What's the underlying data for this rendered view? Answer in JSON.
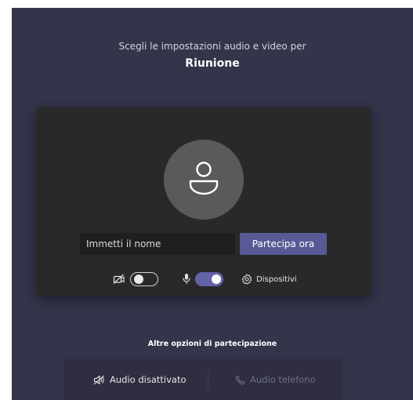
{
  "header": {
    "subtitle": "Scegli le impostazioni audio e video per",
    "meeting_title": "Riunione"
  },
  "preview": {
    "avatar_icon": "person-icon",
    "name_input": {
      "placeholder": "Immetti il nome",
      "value": ""
    },
    "join_button_label": "Partecipa ora",
    "controls": {
      "camera": {
        "icon": "camera-off-icon",
        "enabled": false
      },
      "microphone": {
        "icon": "microphone-icon",
        "enabled": true
      },
      "devices": {
        "icon": "gear-icon",
        "label": "Dispositivi"
      }
    }
  },
  "more_options": {
    "title": "Altre opzioni di partecipazione",
    "items": [
      {
        "icon": "speaker-off-icon",
        "label": "Audio disattivato",
        "enabled": true
      },
      {
        "icon": "phone-icon",
        "label": "Audio telefono",
        "enabled": false
      }
    ]
  },
  "colors": {
    "background": "#34344a",
    "preview_panel": "#292929",
    "accent": "#6264a7",
    "join_button": "#585a96"
  }
}
